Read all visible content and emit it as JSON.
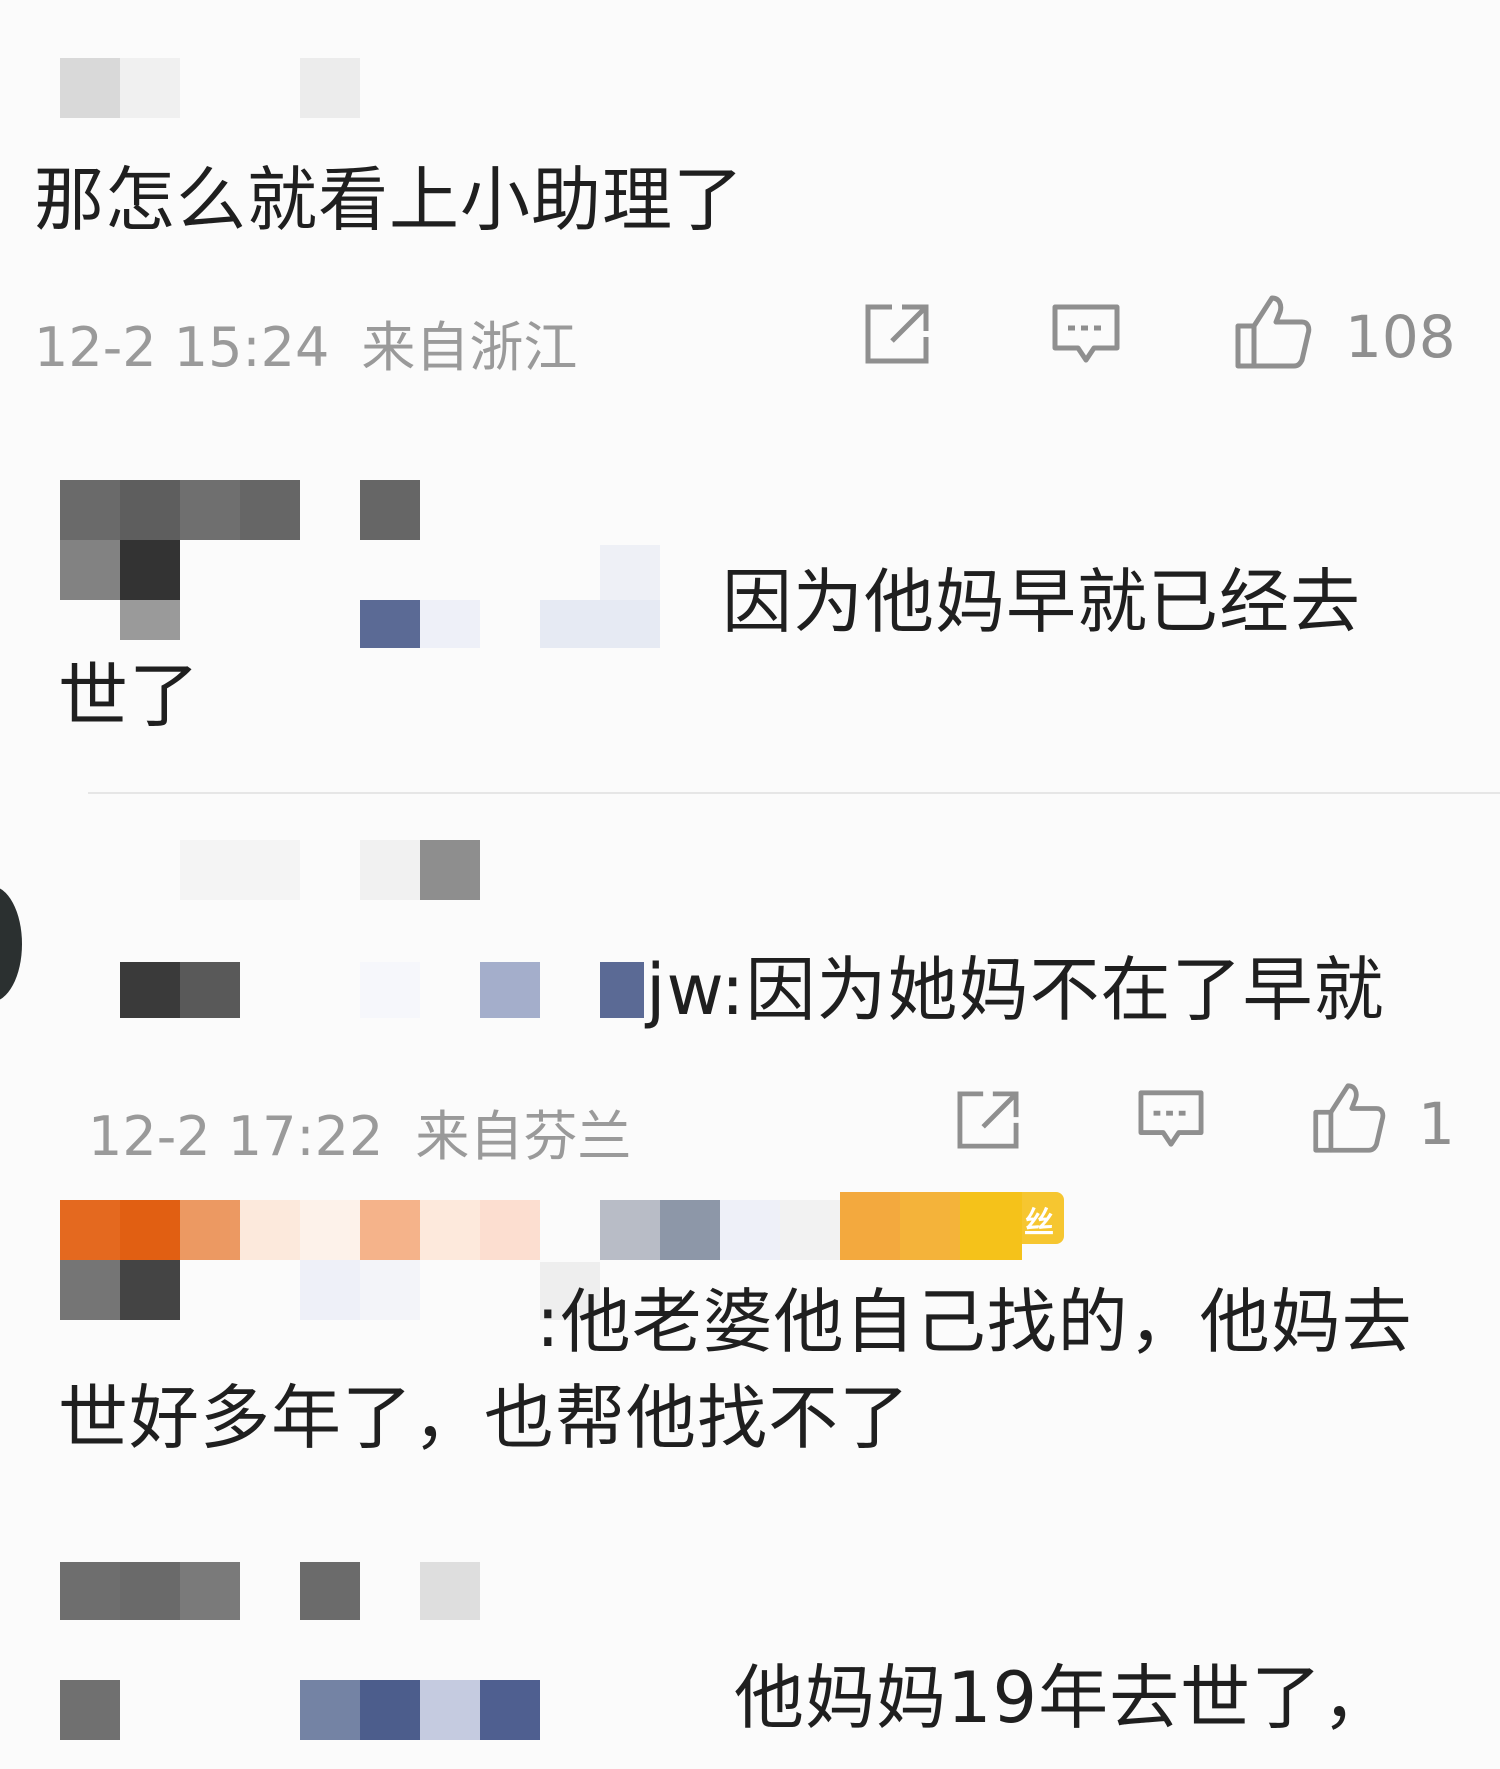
{
  "comments": [
    {
      "text": "那怎么就看上小助理了",
      "time": "12-2 15:24",
      "location": "来自浙江",
      "likes": "108"
    },
    {
      "text_line1": "因为他妈早就已经去",
      "text_line2": "世了"
    },
    {
      "text": "jw:因为她妈不在了早就",
      "time": "12-2 17:22",
      "location": "来自芬兰",
      "likes": "1"
    },
    {
      "badge": "丝",
      "text_line1": ":他老婆他自己找的，他妈去",
      "text_line2": "世好多年了，也帮他找不了"
    },
    {
      "text": "他妈妈19年去世了，"
    }
  ],
  "icons": {
    "share": "share-icon",
    "comment": "comment-icon",
    "like": "thumbs-up-icon"
  },
  "colors": {
    "text": "#1f1f1f",
    "meta": "#9a9a9a",
    "icon": "#8f8f8f",
    "badge": "#f2a93b"
  }
}
